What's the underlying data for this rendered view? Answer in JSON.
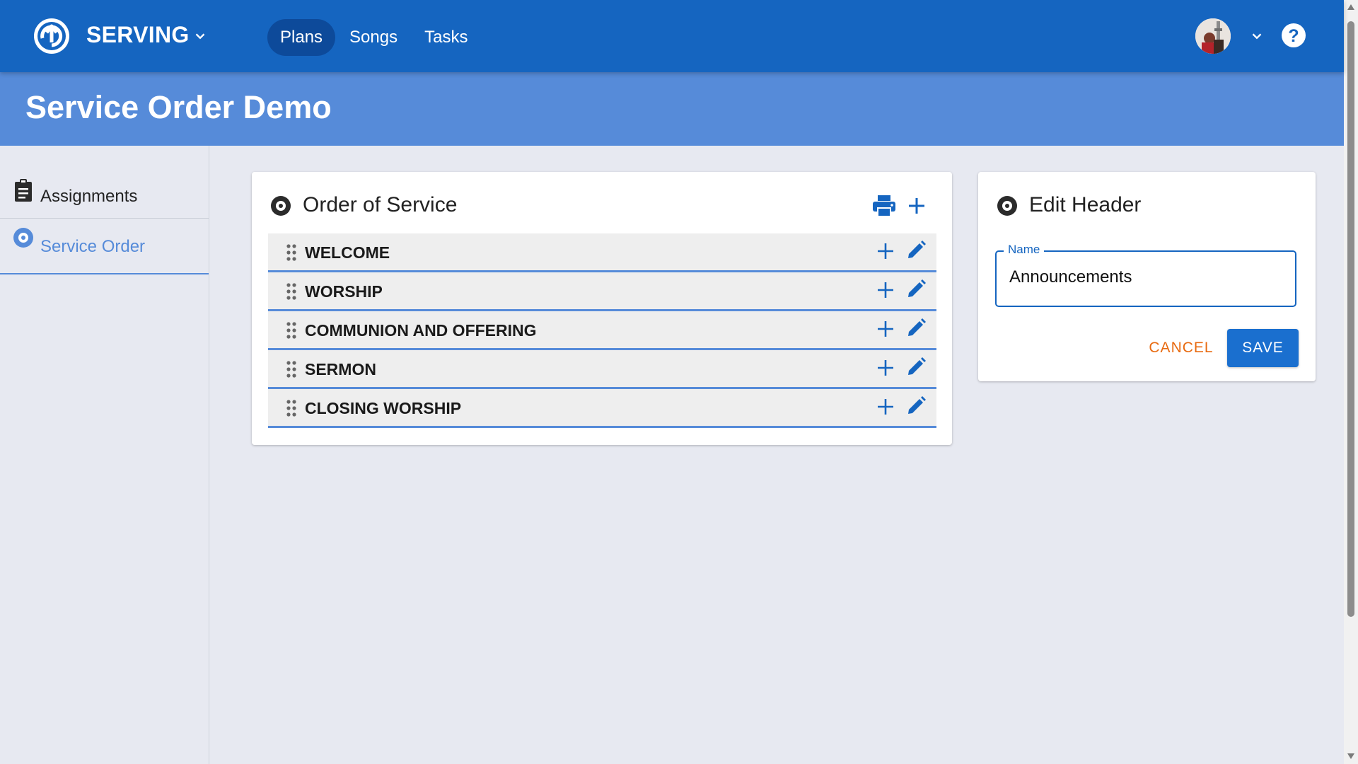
{
  "header": {
    "brand": "SERVING",
    "nav": [
      {
        "label": "Plans",
        "active": true
      },
      {
        "label": "Songs",
        "active": false
      },
      {
        "label": "Tasks",
        "active": false
      }
    ],
    "brand_color": "#1565c0"
  },
  "page": {
    "title": "Service Order Demo",
    "band_color": "#568bd9"
  },
  "sidebar": {
    "items": [
      {
        "label": "Assignments",
        "icon": "clipboard-icon",
        "active": false
      },
      {
        "label": "Service Order",
        "icon": "disc-icon",
        "active": true
      }
    ]
  },
  "order_card": {
    "title": "Order of Service",
    "rows": [
      {
        "label": "WELCOME"
      },
      {
        "label": "WORSHIP"
      },
      {
        "label": "COMMUNION AND OFFERING"
      },
      {
        "label": "SERMON"
      },
      {
        "label": "CLOSING WORSHIP"
      }
    ]
  },
  "edit_card": {
    "title": "Edit Header",
    "field_label": "Name",
    "field_value": "Announcements",
    "cancel_label": "CANCEL",
    "save_label": "SAVE",
    "cancel_color": "#e86a10",
    "save_color": "#1a6fcf"
  }
}
